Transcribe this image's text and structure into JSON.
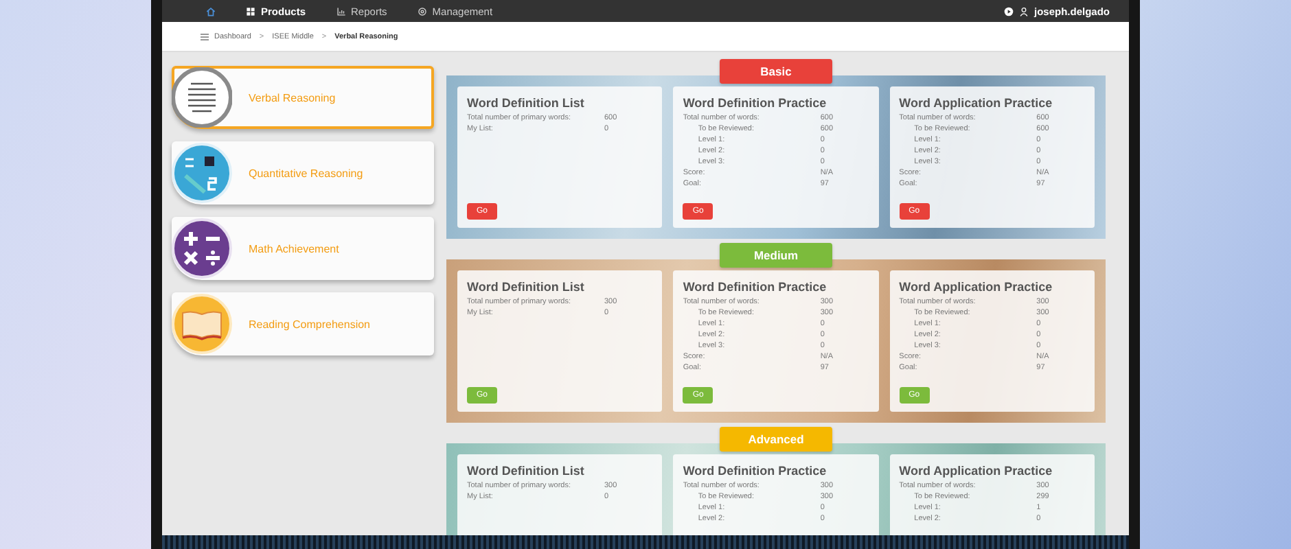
{
  "nav": {
    "items": [
      {
        "kind": "home",
        "selected": false
      },
      {
        "kind": "grid",
        "label": "Products",
        "selected": true
      },
      {
        "kind": "report",
        "label": "Reports",
        "selected": false
      },
      {
        "kind": "gear",
        "label": "Management",
        "selected": false
      }
    ],
    "user": "joseph.delgado"
  },
  "breadcrumb": [
    {
      "label": "Dashboard",
      "separator": ">",
      "selected": false
    },
    {
      "label": "ISEE Middle",
      "separator": ">",
      "selected": false
    },
    {
      "label": "Verbal Reasoning",
      "selected": true
    }
  ],
  "sidebar": {
    "items": [
      {
        "kind": "verbal",
        "label": "Verbal Reasoning",
        "selected": true
      },
      {
        "kind": "quantitative",
        "label": "Quantitative Reasoning",
        "selected": false
      },
      {
        "kind": "math",
        "label": "Math Achievement",
        "selected": false
      },
      {
        "kind": "reading",
        "label": "Reading Comprehension",
        "selected": false
      }
    ]
  },
  "sections": [
    {
      "label": "Basic",
      "color": "#e8413a",
      "cards": [
        {
          "title": "Word Definition List",
          "rows": [
            {
              "kind": "main",
              "label": "Total number of primary words:",
              "value": "600"
            },
            {
              "kind": "main",
              "label": "My List:",
              "value": "0"
            }
          ],
          "button": "Go"
        },
        {
          "title": "Word Definition Practice",
          "rows": [
            {
              "kind": "main",
              "label": "Total number of words:",
              "value": "600"
            },
            {
              "kind": "sub",
              "label": "To be Reviewed:",
              "value": "600"
            },
            {
              "kind": "sub",
              "label": "Level 1:",
              "value": "0"
            },
            {
              "kind": "sub",
              "label": "Level 2:",
              "value": "0"
            },
            {
              "kind": "sub",
              "label": "Level 3:",
              "value": "0"
            },
            {
              "kind": "main",
              "label": "Score:",
              "value": "N/A"
            },
            {
              "kind": "main",
              "label": "Goal:",
              "value": "97"
            }
          ],
          "button": "Go"
        },
        {
          "title": "Word Application Practice",
          "rows": [
            {
              "kind": "main",
              "label": "Total number of words:",
              "value": "600"
            },
            {
              "kind": "sub",
              "label": "To be Reviewed:",
              "value": "600"
            },
            {
              "kind": "sub",
              "label": "Level 1:",
              "value": "0"
            },
            {
              "kind": "sub",
              "label": "Level 2:",
              "value": "0"
            },
            {
              "kind": "sub",
              "label": "Level 3:",
              "value": "0"
            },
            {
              "kind": "main",
              "label": "Score:",
              "value": "N/A"
            },
            {
              "kind": "main",
              "label": "Goal:",
              "value": "97"
            }
          ],
          "button": "Go"
        }
      ]
    },
    {
      "label": "Medium",
      "color": "#7cbb3c",
      "cards": [
        {
          "title": "Word Definition List",
          "rows": [
            {
              "kind": "main",
              "label": "Total number of primary words:",
              "value": "300"
            },
            {
              "kind": "main",
              "label": "My List:",
              "value": "0"
            }
          ],
          "button": "Go"
        },
        {
          "title": "Word Definition Practice",
          "rows": [
            {
              "kind": "main",
              "label": "Total number of words:",
              "value": "300"
            },
            {
              "kind": "sub",
              "label": "To be Reviewed:",
              "value": "300"
            },
            {
              "kind": "sub",
              "label": "Level 1:",
              "value": "0"
            },
            {
              "kind": "sub",
              "label": "Level 2:",
              "value": "0"
            },
            {
              "kind": "sub",
              "label": "Level 3:",
              "value": "0"
            },
            {
              "kind": "main",
              "label": "Score:",
              "value": "N/A"
            },
            {
              "kind": "main",
              "label": "Goal:",
              "value": "97"
            }
          ],
          "button": "Go"
        },
        {
          "title": "Word Application Practice",
          "rows": [
            {
              "kind": "main",
              "label": "Total number of words:",
              "value": "300"
            },
            {
              "kind": "sub",
              "label": "To be Reviewed:",
              "value": "300"
            },
            {
              "kind": "sub",
              "label": "Level 1:",
              "value": "0"
            },
            {
              "kind": "sub",
              "label": "Level 2:",
              "value": "0"
            },
            {
              "kind": "sub",
              "label": "Level 3:",
              "value": "0"
            },
            {
              "kind": "main",
              "label": "Score:",
              "value": "N/A"
            },
            {
              "kind": "main",
              "label": "Goal:",
              "value": "97"
            }
          ],
          "button": "Go"
        }
      ]
    },
    {
      "label": "Advanced",
      "color": "#f5b800",
      "cards": [
        {
          "title": "Word Definition List",
          "rows": [
            {
              "kind": "main",
              "label": "Total number of primary words:",
              "value": "300"
            },
            {
              "kind": "main",
              "label": "My List:",
              "value": "0"
            }
          ]
        },
        {
          "title": "Word Definition Practice",
          "rows": [
            {
              "kind": "main",
              "label": "Total number of words:",
              "value": "300"
            },
            {
              "kind": "sub",
              "label": "To be Reviewed:",
              "value": "300"
            },
            {
              "kind": "sub",
              "label": "Level 1:",
              "value": "0"
            },
            {
              "kind": "sub",
              "label": "Level 2:",
              "value": "0"
            }
          ]
        },
        {
          "title": "Word Application Practice",
          "rows": [
            {
              "kind": "main",
              "label": "Total number of words:",
              "value": "300"
            },
            {
              "kind": "sub",
              "label": "To be Reviewed:",
              "value": "299"
            },
            {
              "kind": "sub",
              "label": "Level 1:",
              "value": "1"
            },
            {
              "kind": "sub",
              "label": "Level 2:",
              "value": "0"
            }
          ]
        }
      ]
    }
  ]
}
